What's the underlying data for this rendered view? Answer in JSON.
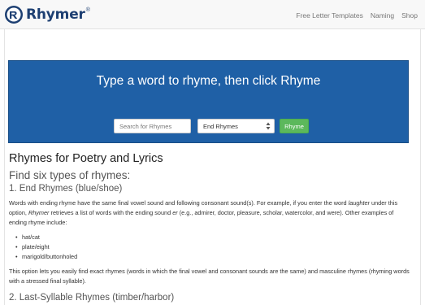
{
  "brand": {
    "name": "Rhymer",
    "registered": "®"
  },
  "nav": {
    "links": [
      {
        "label": "Free Letter Templates"
      },
      {
        "label": "Naming"
      },
      {
        "label": "Shop"
      }
    ]
  },
  "hero": {
    "title": "Type a word to rhyme, then click Rhyme",
    "search": {
      "placeholder": "Search for Rhymes",
      "value": ""
    },
    "select": {
      "selected": "End Rhymes"
    },
    "button_label": "Rhyme"
  },
  "content": {
    "heading": "Rhymes for Poetry and Lyrics",
    "subheading": "Find six types of rhymes:",
    "section1": {
      "title": "1. End Rhymes (blue/shoe)",
      "para1_part1": "Words with ending rhyme have the same final vowel sound and following consonant sound(s). For example, if you enter the word ",
      "para1_em1": "laughter",
      "para1_part2": " under this option, ",
      "para1_em2": "Rhymer",
      "para1_part3": " retrieves a list of words with the ending sound ",
      "para1_em3": "er",
      "para1_part4": " (e.g., admirer, doctor, pleasure, scholar, watercolor, and were). Other examples of ending rhyme include:",
      "examples": [
        "hat/cat",
        "plate/eight",
        "marigold/buttonholed"
      ],
      "para2": "This option lets you easily find exact rhymes (words in which the final vowel and consonant sounds are the same) and masculine rhymes (rhyming words with a stressed final syllable)."
    },
    "section2": {
      "title": "2. Last-Syllable Rhymes (timber/harbor)"
    }
  },
  "colors": {
    "hero_bg": "#1f60a6",
    "button_green": "#5cb85c",
    "brand_navy": "#1d3f72",
    "navbar_bg": "#f8f8f8"
  },
  "icons": {
    "logo": "rhymer-logo-icon",
    "select_arrow": "chevron-updown-icon"
  }
}
